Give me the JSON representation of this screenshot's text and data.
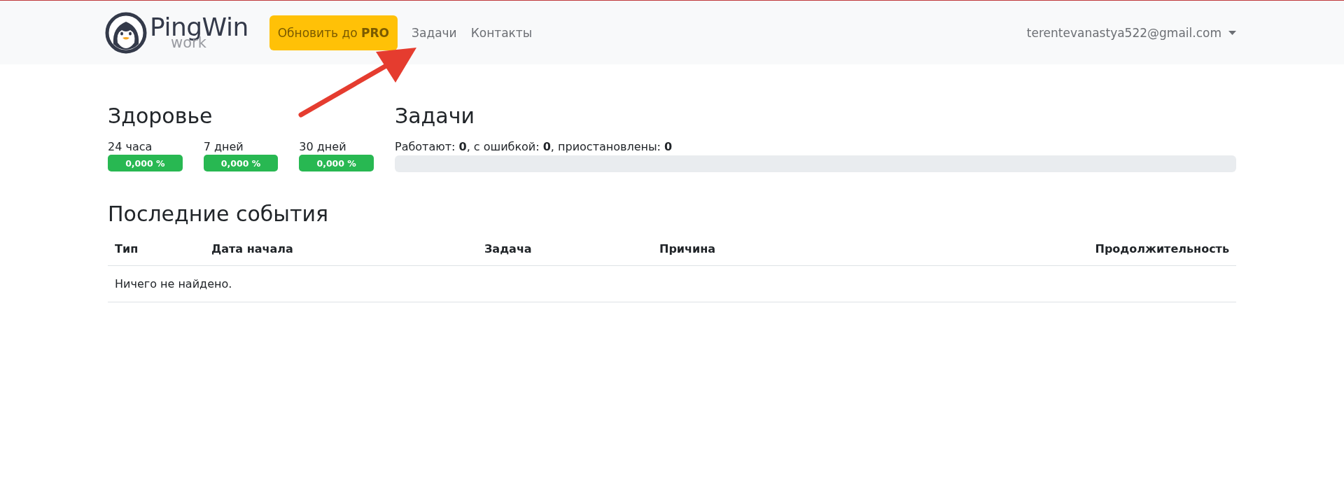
{
  "navbar": {
    "logo": {
      "name": "PingWin",
      "sub": "work"
    },
    "upgrade_button": {
      "text": "Обновить до",
      "bold": "PRO"
    },
    "links": [
      {
        "label": "Задачи"
      },
      {
        "label": "Контакты"
      }
    ],
    "user_menu": {
      "email": "terentevanastya522@gmail.com"
    }
  },
  "health": {
    "title": "Здоровье",
    "periods": [
      {
        "label": "24 часа",
        "value": "0,000 %"
      },
      {
        "label": "7 дней",
        "value": "0,000 %"
      },
      {
        "label": "30 дней",
        "value": "0,000 %"
      }
    ]
  },
  "tasks": {
    "title": "Задачи",
    "summary": "Работают: **0**, с ошибкой: **0**, приостановлены: **0**",
    "level": 0
  },
  "events": {
    "title": "Последние события",
    "columns": [
      {
        "label": "Тип"
      },
      {
        "label": "Дата начала"
      },
      {
        "label": "Задача"
      },
      {
        "label": "Причина"
      },
      {
        "label": "Продолжительность"
      }
    ],
    "empty_text": "Ничего не найдено."
  }
}
